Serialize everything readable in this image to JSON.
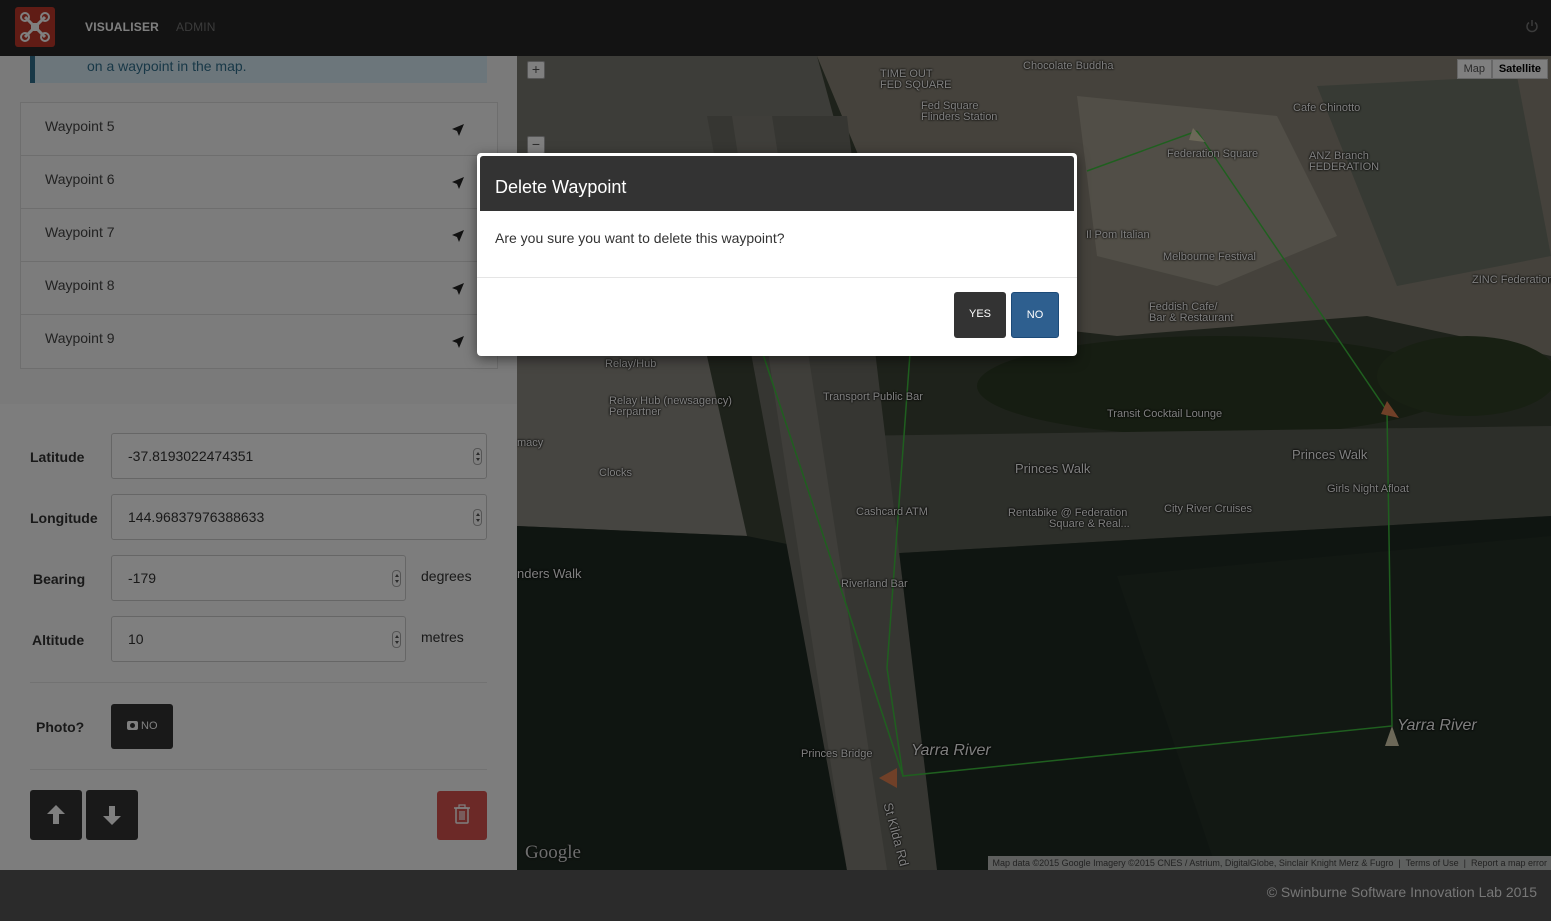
{
  "navbar": {
    "brand": "drone-logo",
    "links": [
      "VISUALISER",
      "ADMIN"
    ],
    "active": "VISUALISER",
    "power_icon": "power-icon"
  },
  "left_panel": {
    "info_text": "on a waypoint in the map.",
    "waypoints": [
      {
        "label": "Waypoint 5"
      },
      {
        "label": "Waypoint 6"
      },
      {
        "label": "Waypoint 7"
      },
      {
        "label": "Waypoint 8"
      },
      {
        "label": "Waypoint 9"
      }
    ],
    "form": {
      "latitude_label": "Latitude",
      "latitude_value": "-37.8193022474351",
      "longitude_label": "Longitude",
      "longitude_value": "144.96837976388633",
      "bearing_label": "Bearing",
      "bearing_value": "-179",
      "bearing_unit": "degrees",
      "altitude_label": "Altitude",
      "altitude_value": "10",
      "altitude_unit": "metres",
      "photo_label": "Photo?",
      "photo_button": "NO"
    }
  },
  "map": {
    "type_buttons": [
      "Map",
      "Satellite"
    ],
    "selected_type": "Satellite",
    "zoom_in": "+",
    "zoom_out": "−",
    "google_logo": "Google",
    "attribution": "Map data ©2015 Google Imagery ©2015 CNES / Astrium, DigitalGlobe, Sinclair Knight Merz & Fugro",
    "terms": "Terms of Use",
    "report": "Report a map error",
    "labels": {
      "time_out": "TIME OUT",
      "fed_square_top": "FED SQUARE",
      "chocolate_buddha": "Chocolate Buddha",
      "fed_square_station_1": "Fed Square",
      "fed_square_station_2": "Flinders Station",
      "cafe_chinotto": "Cafe Chinotto",
      "federation_square": "Federation Square",
      "anz_1": "ANZ Branch",
      "anz_2": "FEDERATION",
      "il_pom": "Il Pom Italian",
      "melbourne_festival": "Melbourne Festival",
      "zinc": "ZINC Federation",
      "feddish_1": "Feddish Cafe/",
      "feddish_2": "Bar & Restaurant",
      "relay_hub": "Relay/Hub",
      "relay_news_1": "Relay Hub (newsagency)",
      "relay_news_2": "Perpartner",
      "transport_bar": "Transport Public Bar",
      "transit_lounge": "Transit Cocktail Lounge",
      "princes_walk_1": "Princes Walk",
      "princes_walk_2": "Princes Walk",
      "pharmacy": "macy",
      "clocks": "Clocks",
      "girls_night": "Girls Night Afloat",
      "cashcard": "Cashcard ATM",
      "rentabike_1": "Rentabike @ Federation",
      "rentabike_2": "Square & Real...",
      "city_river_cruises": "City River Cruises",
      "ders_walk": "nders Walk",
      "riverland": "Riverland Bar",
      "princes_bridge": "Princes Bridge",
      "yarra_1": "Yarra River",
      "yarra_2": "Yarra River",
      "st_kilda": "St Kilda Rd"
    }
  },
  "modal": {
    "title": "Delete Waypoint",
    "body": "Are you sure you want to delete this waypoint?",
    "yes_label": "YES",
    "no_label": "NO"
  },
  "footer": {
    "copyright": "© Swinburne Software Innovation Lab 2015"
  },
  "colors": {
    "navbar": "#262626",
    "logo": "#c0392b",
    "primary": "#2e5f8f",
    "danger": "#d9534f",
    "route": "#3fbf3f"
  }
}
